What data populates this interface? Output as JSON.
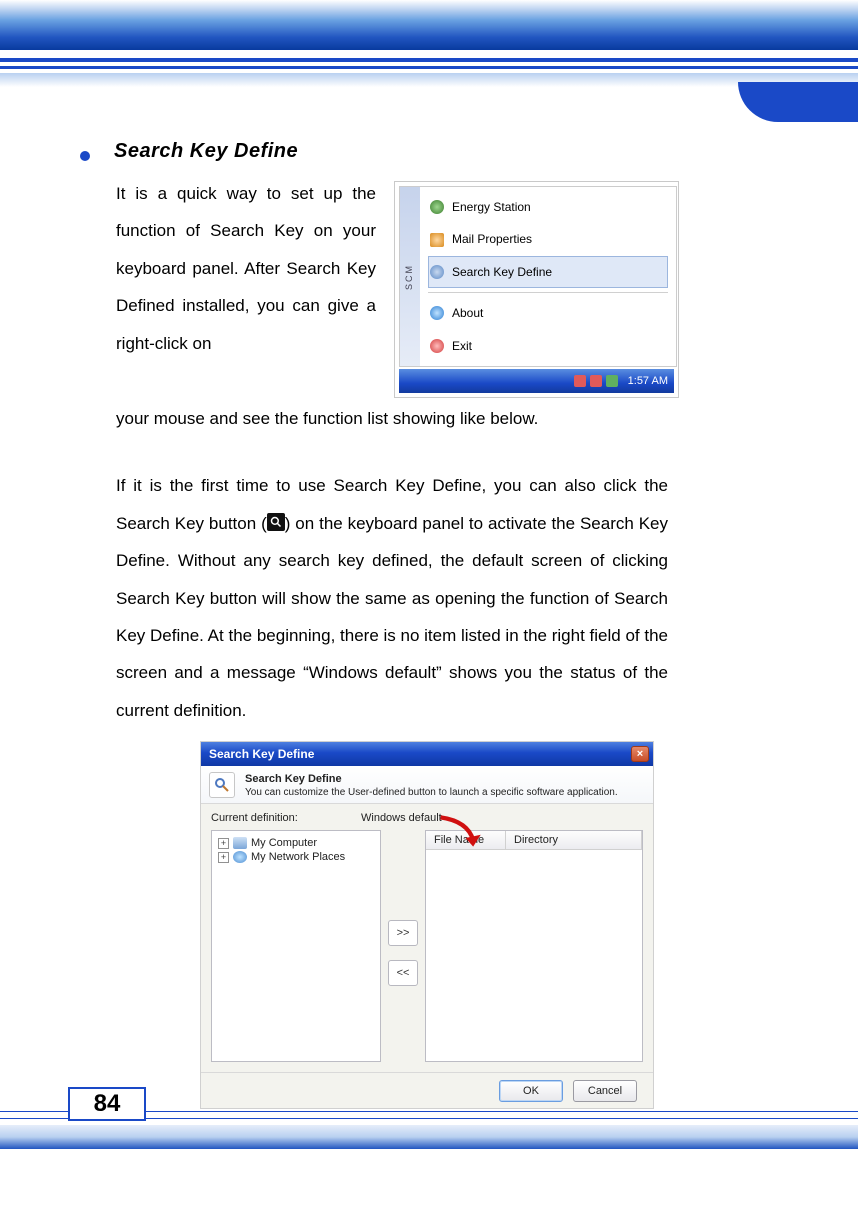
{
  "page_number": "84",
  "heading": "Search Key Define",
  "paragraph1a": "It is a quick way to set up the function of Search Key on your keyboard panel.  After Search Key Defined installed, you can give a right-click on",
  "paragraph1b": "your mouse and see the function list showing like below.",
  "paragraph2a": "If it is the first time to use Search Key Define, you can also click the Search Key button (",
  "paragraph2b": ") on the keyboard panel to activate the Search Key Define.  Without any search key defined, the default screen of clicking Search Key button will show the same as opening the function of Search Key Define.  At the beginning, there is no item listed in the right field of the screen and a message “Windows default” shows you the status of the current definition.",
  "tray": {
    "sidebar_label": "SCM",
    "items": {
      "energy": "Energy Station",
      "mail": "Mail Properties",
      "search": "Search Key Define",
      "about": "About",
      "exit": "Exit"
    },
    "time": "1:57 AM"
  },
  "dialog": {
    "title": "Search Key Define",
    "banner_title": "Search Key Define",
    "banner_desc": "You can customize the User-defined button to launch a specific software application.",
    "current_def_label": "Current definition:",
    "current_def_value": "Windows default",
    "tree": {
      "item1": "My Computer",
      "item2": "My Network Places"
    },
    "buttons": {
      "add": ">>",
      "remove": "<<"
    },
    "columns": {
      "file_name": "File Name",
      "directory": "Directory"
    },
    "footer": {
      "ok": "OK",
      "cancel": "Cancel"
    }
  }
}
